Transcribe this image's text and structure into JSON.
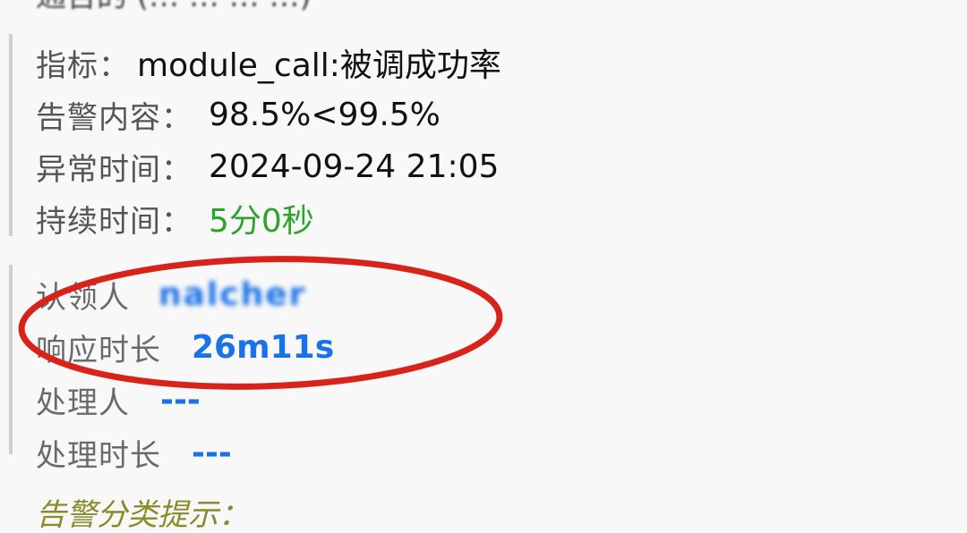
{
  "metrics": {
    "metric": {
      "label": "指标：",
      "value": "module_call:被调成功率"
    },
    "alert_content": {
      "label": "告警内容：",
      "value": "98.5%<99.5%"
    },
    "abnormal_time": {
      "label": "异常时间：",
      "value": "2024-09-24 21:05"
    },
    "duration": {
      "label": "持续时间：",
      "value": "5分0秒"
    }
  },
  "handling": {
    "claimer": {
      "label": "认领人",
      "value": "nalcher"
    },
    "response_time": {
      "label": "响应时长",
      "value": "26m11s"
    },
    "handler": {
      "label": "处理人",
      "value": "---"
    },
    "handling_time": {
      "label": "处理时长",
      "value": "---"
    }
  },
  "colors": {
    "duration_value": "#2aa52a",
    "handling_value": "#1a72e8",
    "annotation_circle": "#d8231b",
    "section_border": "#cfcfd4"
  }
}
